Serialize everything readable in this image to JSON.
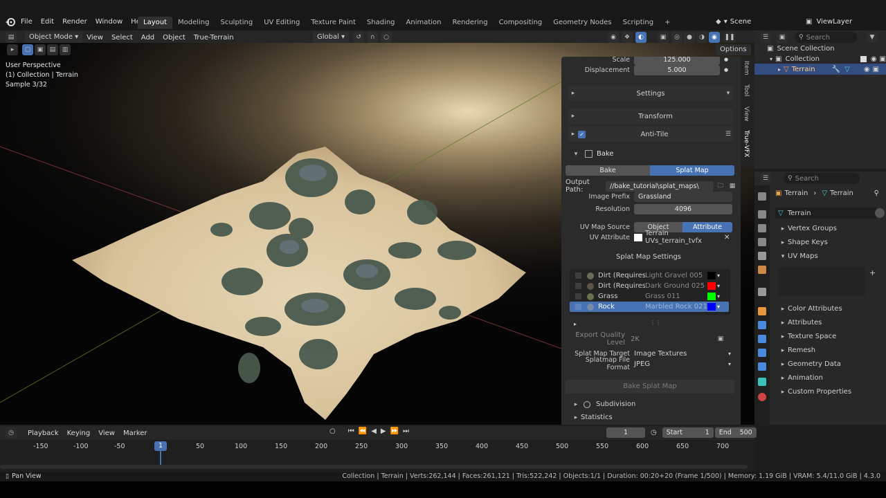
{
  "menu": [
    "File",
    "Edit",
    "Render",
    "Window",
    "Help"
  ],
  "workspaces": [
    "Layout",
    "Modeling",
    "Sculpting",
    "UV Editing",
    "Texture Paint",
    "Shading",
    "Animation",
    "Rendering",
    "Compositing",
    "Geometry Nodes",
    "Scripting"
  ],
  "active_workspace": "Layout",
  "scene": "Scene",
  "view_layer": "ViewLayer",
  "viewport": {
    "mode": "Object Mode",
    "menus": [
      "View",
      "Select",
      "Add",
      "Object",
      "True-Terrain"
    ],
    "transform": "Global",
    "options": "Options",
    "info_lines": [
      "User Perspective",
      "(1) Collection | Terrain",
      "Sample 3/32"
    ]
  },
  "npanel": {
    "scale_label": "Scale",
    "scale_value": "125.000",
    "displacement_label": "Displacement",
    "displacement_value": "5.000",
    "settings": "Settings",
    "transform": "Transform",
    "anti_tile": "Anti-Tile",
    "bake": "Bake",
    "bake_tabs": [
      "Bake",
      "Splat Map"
    ],
    "output_path_label": "Output Path:",
    "output_path_value": "//bake_tutorial\\splat_maps\\",
    "image_prefix_label": "Image Prefix",
    "image_prefix_value": "Grassland",
    "resolution_label": "Resolution",
    "resolution_value": "4096",
    "uv_map_source_label": "UV Map Source",
    "uv_map_source_options": [
      "Object",
      "Attribute"
    ],
    "uv_attribute_label": "UV Attribute",
    "uv_attribute_value": "Terrain UVs_terrain_tvfx",
    "splat_settings": "Splat Map Settings",
    "splat_rows": [
      {
        "name": "Dirt (Requires ...",
        "material": "Light Gravel 005",
        "color": "#000000"
      },
      {
        "name": "Dirt (Requires ...",
        "material": "Dark Ground 025",
        "color": "#ff0000"
      },
      {
        "name": "Grass",
        "material": "Grass 011",
        "color": "#00ff00"
      },
      {
        "name": "Rock",
        "material": "Marbled Rock 021",
        "color": "#0000ff"
      }
    ],
    "export_quality_label": "Export Quality Level",
    "export_quality_value": "2K",
    "splat_target_label": "Splat Map Target",
    "splat_target_value": "Image Textures",
    "file_format_label": "Splatmap File Format",
    "file_format_value": "JPEG",
    "bake_button": "Bake Splat Map",
    "subdivision": "Subdivision",
    "statistics": "Statistics",
    "vertical_tabs": [
      "Item",
      "Tool",
      "View",
      "True-VFX"
    ]
  },
  "outliner": {
    "search_placeholder": "Search",
    "items": [
      "Scene Collection",
      "Collection",
      "Terrain"
    ]
  },
  "properties": {
    "search_placeholder": "Search",
    "breadcrumb": [
      "Terrain",
      "Terrain"
    ],
    "data_name": "Terrain",
    "sections": [
      "Vertex Groups",
      "Shape Keys",
      "UV Maps",
      "Color Attributes",
      "Attributes",
      "Texture Space",
      "Remesh",
      "Geometry Data",
      "Animation",
      "Custom Properties"
    ]
  },
  "timeline": {
    "menus": [
      "Playback",
      "Keying",
      "View",
      "Marker"
    ],
    "current_frame": "1",
    "start_label": "Start",
    "start_value": "1",
    "end_label": "End",
    "end_value": "500",
    "ticks": [
      "-150",
      "-100",
      "-50",
      "1",
      "50",
      "100",
      "150",
      "200",
      "250",
      "300",
      "350",
      "400",
      "450",
      "500",
      "550",
      "600",
      "650",
      "700"
    ]
  },
  "status": {
    "left": "Pan View",
    "right": "Collection | Terrain | Verts:262,144 | Faces:261,121 | Tris:522,242 | Objects:1/1 | Duration: 00:20+20 (Frame 1/500) | Memory: 1.19 GiB | VRAM: 5.4/11.0 GiB | 4.3.0"
  },
  "colors": {
    "accent": "#4772b3",
    "panel": "#2b2b2b"
  }
}
